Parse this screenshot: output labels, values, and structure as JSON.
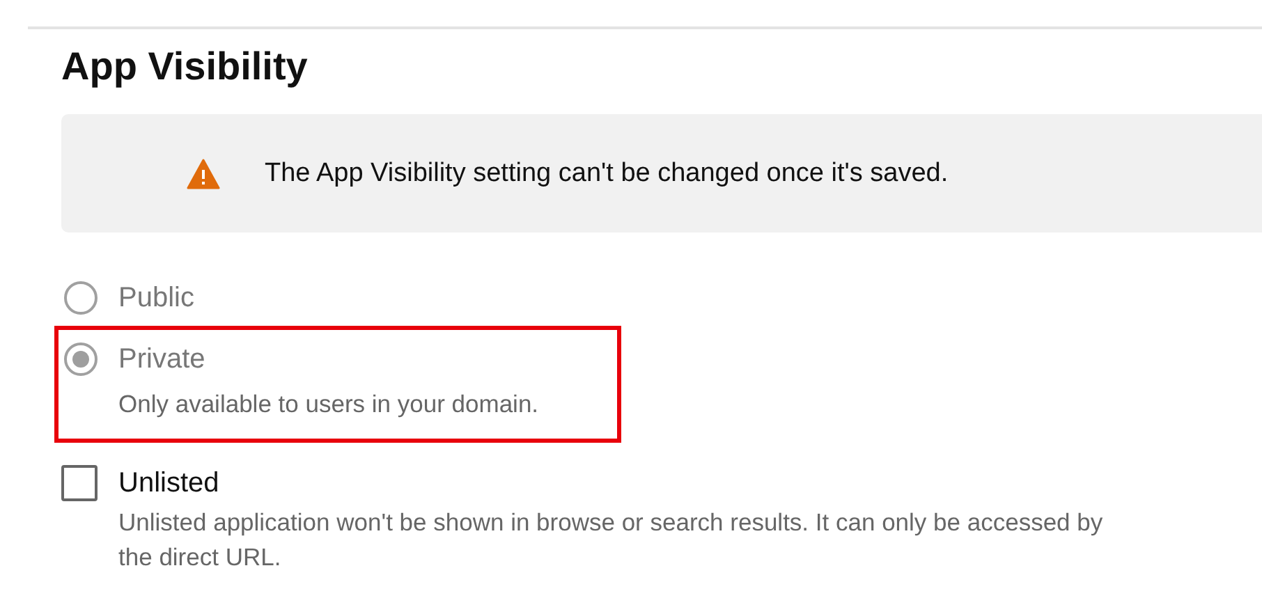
{
  "section": {
    "title": "App Visibility"
  },
  "notice": {
    "kind": "warning",
    "text": "The App Visibility setting can't be changed once it's saved."
  },
  "options": [
    {
      "kind": "radio",
      "label": "Public",
      "selected": false,
      "disabled": true,
      "highlighted": false
    },
    {
      "kind": "radio",
      "label": "Private",
      "description": "Only available to users in your domain.",
      "selected": true,
      "disabled": true,
      "highlighted": true
    },
    {
      "kind": "checkbox",
      "label": "Unlisted",
      "description": "Unlisted application won't be shown in browse or search results. It can only be accessed by the direct URL.",
      "checked": false,
      "disabled": false,
      "highlighted": false
    }
  ]
}
